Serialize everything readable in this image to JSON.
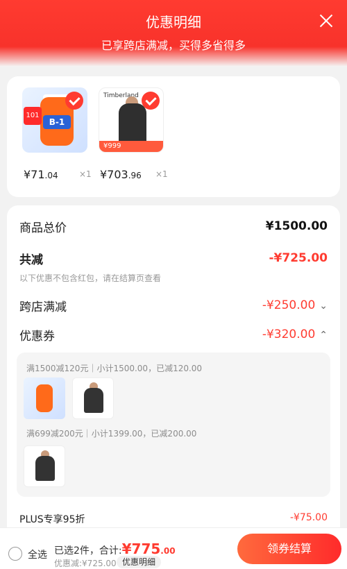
{
  "header": {
    "title": "优惠明细",
    "subtitle": "已享跨店满减，买得多省得多"
  },
  "products": [
    {
      "name": "NOW B-1",
      "price_main": "¥71",
      "price_dec": ".04",
      "qty": "×1"
    },
    {
      "name": "Timberland jacket",
      "price_main": "¥703",
      "price_dec": ".96",
      "qty": "×1"
    }
  ],
  "summary": {
    "total_label": "商品总价",
    "total_value": "¥1500.00",
    "reduce_label": "共减",
    "reduce_value": "-¥725.00",
    "note": "以下优惠不包含红包，请在结算页查看",
    "cross_label": "跨店满减",
    "cross_value": "-¥250.00",
    "coupon_label": "优惠券",
    "coupon_value": "-¥320.00",
    "coupon_line1": "满1500减120元｜小计1500.00，已减120.00",
    "coupon_line2": "满699减200元｜小计1399.00，已减200.00",
    "plus_label": "PLUS专享95折",
    "plus_value": "-¥75.00"
  },
  "footer": {
    "select_all": "全选",
    "selected_prefix": "已选2件，合计:",
    "total_main": "¥775",
    "total_dec": ".00",
    "saving": "优惠减:¥725.00",
    "detail_pill": "优惠明细",
    "pay_button": "领券结算"
  }
}
